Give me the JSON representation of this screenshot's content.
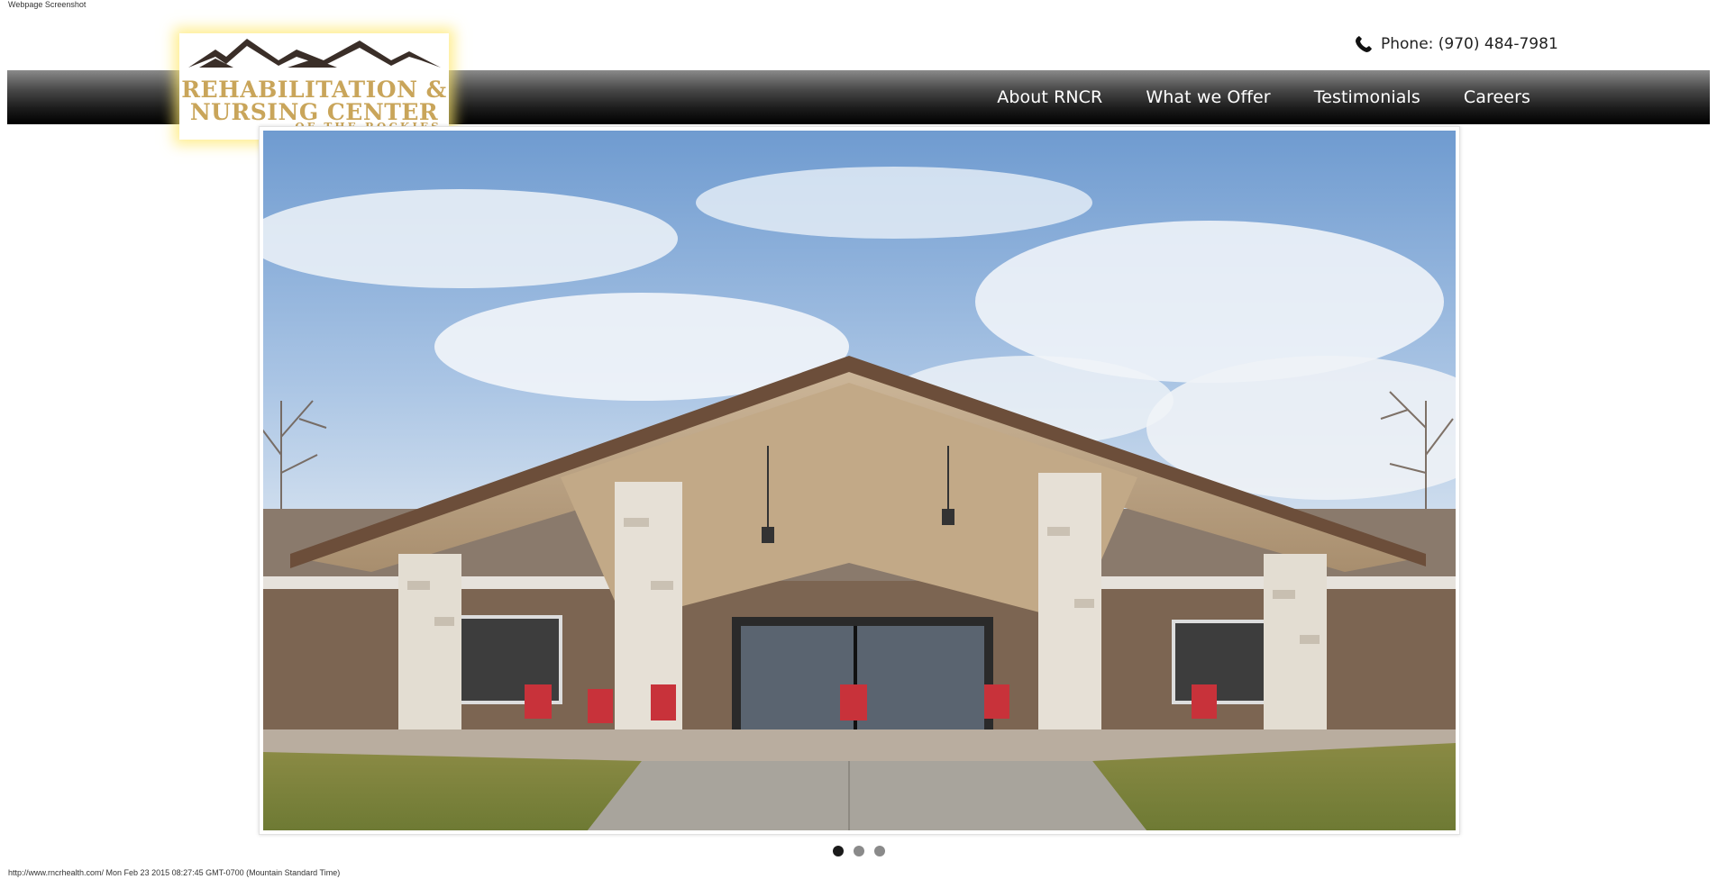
{
  "page": {
    "caption_top": "Webpage Screenshot",
    "caption_bottom": "http://www.rncrhealth.com/ Mon Feb 23 2015 08:27:45 GMT-0700 (Mountain Standard Time)"
  },
  "header": {
    "phone_label": "Phone:",
    "phone_number": "(970) 484-7981",
    "phone_icon": "phone-icon"
  },
  "logo": {
    "line1": "REHABILITATION &",
    "line2": "NURSING CENTER",
    "line3": "OF THE ROCKIES",
    "mountains_icon": "mountains-icon"
  },
  "nav": {
    "items": [
      {
        "label": "About RNCR"
      },
      {
        "label": "What we Offer"
      },
      {
        "label": "Testimonials"
      },
      {
        "label": "Careers"
      }
    ]
  },
  "slider": {
    "total_slides": 3,
    "active_slide": 1
  },
  "colors": {
    "logo_gold": "#c9a55a",
    "logo_glow": "#ffe86e",
    "nav_text": "#ffffff",
    "dot_active": "#1a1a1a",
    "dot_inactive": "#8a8a8a"
  }
}
